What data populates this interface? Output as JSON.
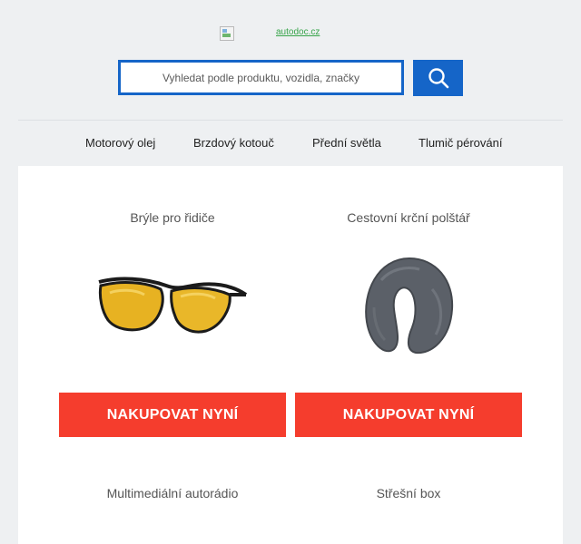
{
  "header": {
    "logo_alt": "autodoc.cz",
    "search": {
      "placeholder": "Vyhledat podle produktu, vozidla, značky",
      "icon": "search-icon"
    }
  },
  "nav": {
    "items": [
      "Motorový olej",
      "Brzdový kotouč",
      "Přední světla",
      "Tlumič pérování"
    ]
  },
  "products": [
    {
      "title": "Brýle pro řidiče",
      "cta": "NAKUPOVAT NYNÍ",
      "image": "sunglasses-image"
    },
    {
      "title": "Cestovní krční polštář",
      "cta": "NAKUPOVAT NYNÍ",
      "image": "neck-pillow-image"
    },
    {
      "title": "Multimediální autorádio"
    },
    {
      "title": "Střešní box"
    }
  ],
  "colors": {
    "brand_blue": "#1565c8",
    "cta_red": "#f53d2d",
    "logo_link": "#37a44a"
  }
}
